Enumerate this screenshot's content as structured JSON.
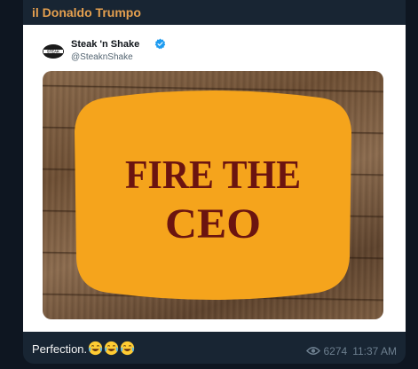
{
  "sender": {
    "name": "il Donaldo Trumpo"
  },
  "tweet": {
    "author_name": "Steak 'n Shake",
    "handle": "@SteaknShake",
    "avatar_icon": "steak-n-shake-logo-icon",
    "verified_icon": "verified-badge-icon",
    "image": {
      "line1": "Fire the",
      "line2": "Ceo",
      "sign_color": "#f5a41c",
      "text_color": "#6b1410"
    }
  },
  "message": {
    "caption": "Perfection.",
    "emojis": [
      "laughing-tears-emoji",
      "laughing-tears-emoji",
      "laughing-tears-emoji"
    ],
    "views": "6274",
    "time": "11:37 AM"
  },
  "colors": {
    "background": "#0e1621",
    "bubble": "#182533",
    "sender": "#e5a04f",
    "meta": "#6d7f8f"
  }
}
